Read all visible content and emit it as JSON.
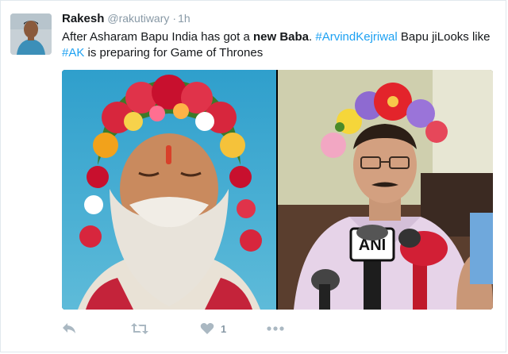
{
  "tweet": {
    "author_name": "Rakesh",
    "author_handle": "@rakutiwary",
    "separator": "·",
    "time": "1h",
    "text_segments": [
      {
        "text": "After Asharam Bapu India has got a ",
        "style": "plain"
      },
      {
        "text": "new Baba",
        "style": "bold"
      },
      {
        "text": ". ",
        "style": "plain"
      },
      {
        "text": "#ArvindKejriwal",
        "style": "hashtag"
      },
      {
        "text": " Bapu jiLooks like ",
        "style": "plain"
      },
      {
        "text": "#AK",
        "style": "hashtag"
      },
      {
        "text": " is preparing for Game of Thrones",
        "style": "plain"
      }
    ],
    "media": {
      "left_photo_icon": "photo-bearded-man-flower-crown",
      "right_photo_icon": "photo-man-flower-crown-microphones",
      "mic_label": "ANI"
    },
    "actions": {
      "reply_icon": "reply-icon",
      "retweet_icon": "retweet-icon",
      "like_icon": "heart-icon",
      "like_count": "1",
      "more_icon": "more-icon"
    }
  },
  "colors": {
    "hashtag": "#1da1f2",
    "muted": "#8899a6",
    "action_icon": "#aab8c2",
    "border": "#e1e8ed"
  }
}
